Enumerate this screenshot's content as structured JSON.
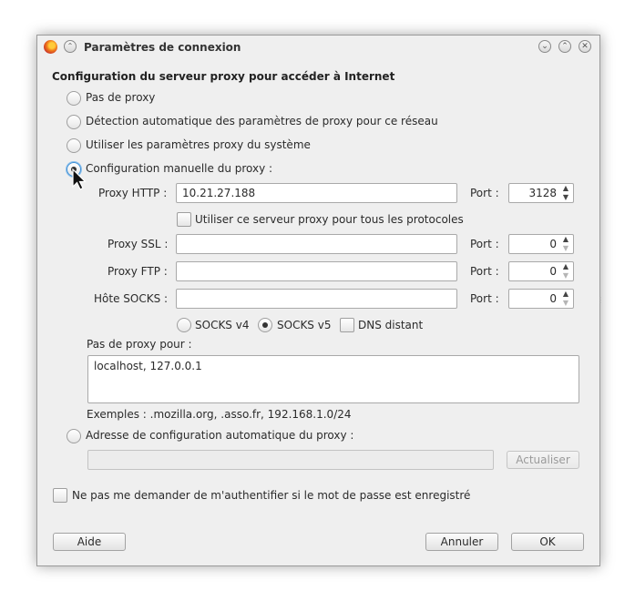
{
  "window": {
    "title": "Paramètres de connexion",
    "app_icon": "firefox-icon",
    "controls": [
      "minimize-icon",
      "maximize-icon",
      "close-icon"
    ]
  },
  "section_title": "Configuration du serveur proxy pour accéder à Internet",
  "proxy_modes": {
    "no_proxy": "Pas de proxy",
    "auto_detect": "Détection automatique des paramètres de proxy pour ce réseau",
    "system": "Utiliser les paramètres proxy du système",
    "manual": "Configuration manuelle du proxy :",
    "pac": "Adresse de configuration automatique du proxy :",
    "selected": "manual"
  },
  "manual": {
    "http_label": "Proxy HTTP :",
    "http_value": "10.21.27.188",
    "http_port": "3128",
    "use_for_all_label": "Utiliser ce serveur proxy pour tous les protocoles",
    "ssl_label": "Proxy SSL :",
    "ssl_value": "",
    "ssl_port": "0",
    "ftp_label": "Proxy FTP :",
    "ftp_value": "",
    "ftp_port": "0",
    "socks_label": "Hôte SOCKS :",
    "socks_value": "",
    "socks_port": "0",
    "port_label": "Port :",
    "socks_v4": "SOCKS v4",
    "socks_v5": "SOCKS v5",
    "socks_selected": "v5",
    "remote_dns": "DNS distant"
  },
  "no_proxy_for": {
    "label": "Pas de proxy pour :",
    "value": "localhost, 127.0.0.1",
    "example": "Exemples : .mozilla.org, .asso.fr, 192.168.1.0/24"
  },
  "pac": {
    "url_value": "",
    "reload_label": "Actualiser"
  },
  "auth_checkbox_label": "Ne pas me demander de m'authentifier si le mot de passe est enregistré",
  "buttons": {
    "help": "Aide",
    "cancel": "Annuler",
    "ok": "OK"
  }
}
